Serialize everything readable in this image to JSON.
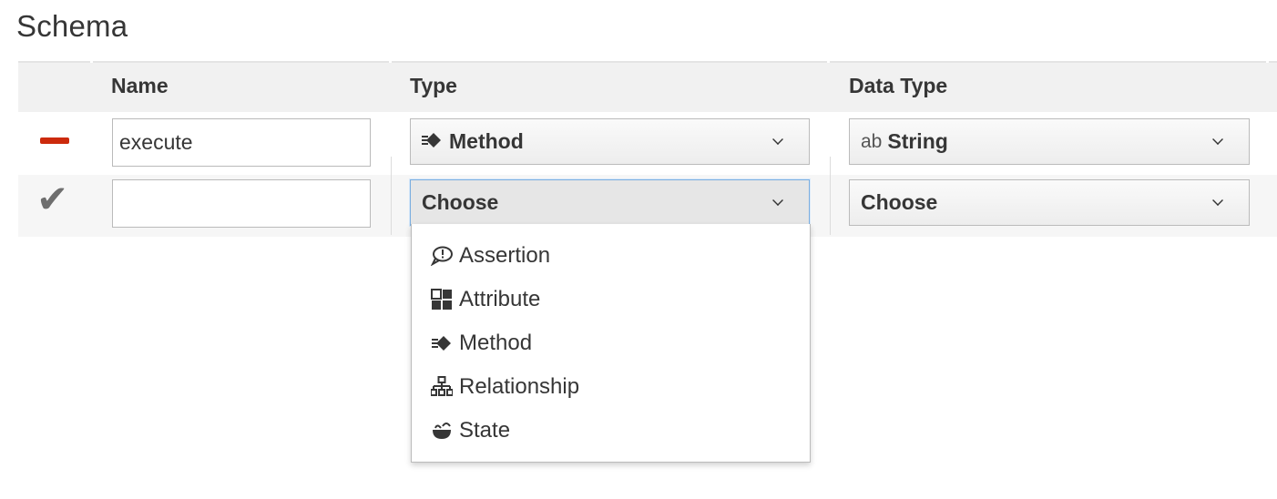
{
  "section": {
    "title": "Schema"
  },
  "table": {
    "headers": {
      "name": "Name",
      "type": "Type",
      "data_type": "Data Type"
    },
    "rows": [
      {
        "name_value": "execute",
        "type_value": "Method",
        "type_icon": "method-icon",
        "data_type_prefix": "ab",
        "data_type_value": "String",
        "row_action_icon": "remove-minus-icon"
      },
      {
        "name_value": "",
        "type_value": "Choose",
        "data_type_value": "Choose",
        "row_action_icon": "confirm-check-icon"
      }
    ]
  },
  "type_dropdown": {
    "options": [
      {
        "label": "Assertion",
        "icon": "assertion-speech-icon"
      },
      {
        "label": "Attribute",
        "icon": "attribute-grid-icon"
      },
      {
        "label": "Method",
        "icon": "method-icon"
      },
      {
        "label": "Relationship",
        "icon": "relationship-tree-icon"
      },
      {
        "label": "State",
        "icon": "state-icon"
      }
    ]
  },
  "colors": {
    "remove_accent": "#cc2a0c",
    "header_bg": "#f1f1f1",
    "focus_border": "#7aaee0"
  }
}
